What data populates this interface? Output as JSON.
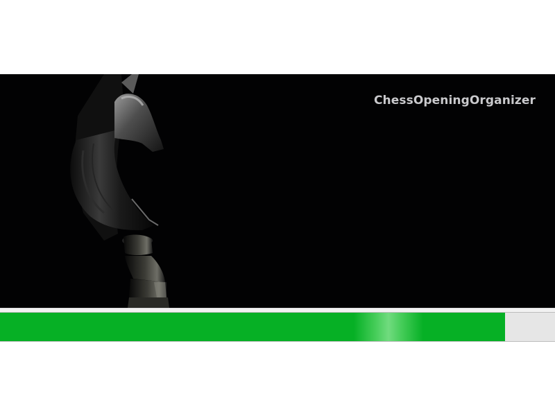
{
  "app": {
    "title": "ChessOpeningOrganizer"
  },
  "splash": {
    "image_subject": "chess knight piece on black background"
  },
  "progress": {
    "fraction": 0.91,
    "fill_color": "#06b025",
    "track_color": "#e6e6e6"
  },
  "icons": {
    "knight": "chess-knight-icon"
  }
}
